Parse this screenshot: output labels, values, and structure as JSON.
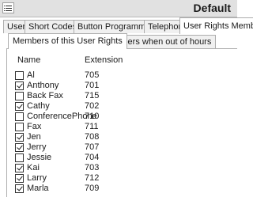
{
  "window": {
    "title": "Default",
    "menu_icon": "hamburger-menu-icon"
  },
  "outer_tabs": [
    {
      "label": "User",
      "active": false
    },
    {
      "label": "Short Codes",
      "active": false
    },
    {
      "label": "Button Programming",
      "active": false
    },
    {
      "label": "Telephony",
      "active": false
    },
    {
      "label": "User Rights Memb",
      "active": true
    }
  ],
  "inner_tabs": [
    {
      "label": "Members of this User Rights",
      "active": true
    },
    {
      "label": "Members when out of hours",
      "active": false
    }
  ],
  "list": {
    "columns": {
      "name": "Name",
      "extension": "Extension"
    },
    "rows": [
      {
        "name": "Al",
        "extension": "705",
        "checked": false
      },
      {
        "name": "Anthony",
        "extension": "701",
        "checked": true
      },
      {
        "name": "Back Fax",
        "extension": "715",
        "checked": false
      },
      {
        "name": "Cathy",
        "extension": "702",
        "checked": true
      },
      {
        "name": "ConferencePhone",
        "extension": "710",
        "checked": false
      },
      {
        "name": "Fax",
        "extension": "711",
        "checked": false
      },
      {
        "name": "Jen",
        "extension": "708",
        "checked": true
      },
      {
        "name": "Jerry",
        "extension": "707",
        "checked": true
      },
      {
        "name": "Jessie",
        "extension": "704",
        "checked": false
      },
      {
        "name": "Kai",
        "extension": "703",
        "checked": true
      },
      {
        "name": "Larry",
        "extension": "712",
        "checked": true
      },
      {
        "name": "Marla",
        "extension": "709",
        "checked": true
      }
    ]
  }
}
